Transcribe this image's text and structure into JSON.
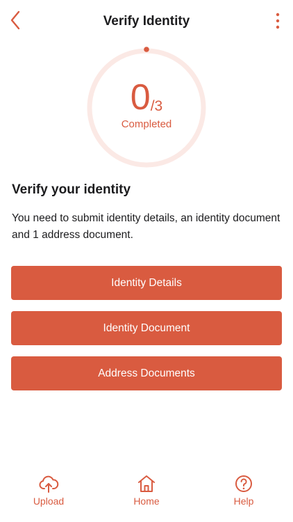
{
  "header": {
    "title": "Verify Identity",
    "back_icon": "chevron-left-icon",
    "more_icon": "more-vertical-icon"
  },
  "progress": {
    "completed": "0",
    "total": "/3",
    "label": "Completed",
    "fraction": 0
  },
  "content": {
    "heading": "Verify your identity",
    "description": "You need to submit identity details, an identity document and 1 address document."
  },
  "actions": [
    {
      "label": "Identity Details"
    },
    {
      "label": "Identity Document"
    },
    {
      "label": "Address Documents"
    }
  ],
  "nav": {
    "items": [
      {
        "label": "Upload",
        "icon": "cloud-upload-icon"
      },
      {
        "label": "Home",
        "icon": "home-icon"
      },
      {
        "label": "Help",
        "icon": "help-circle-icon"
      }
    ]
  },
  "colors": {
    "accent": "#d95b40",
    "ring_track": "#fbe9e5",
    "text": "#1c1c1e",
    "background": "#ffffff"
  }
}
